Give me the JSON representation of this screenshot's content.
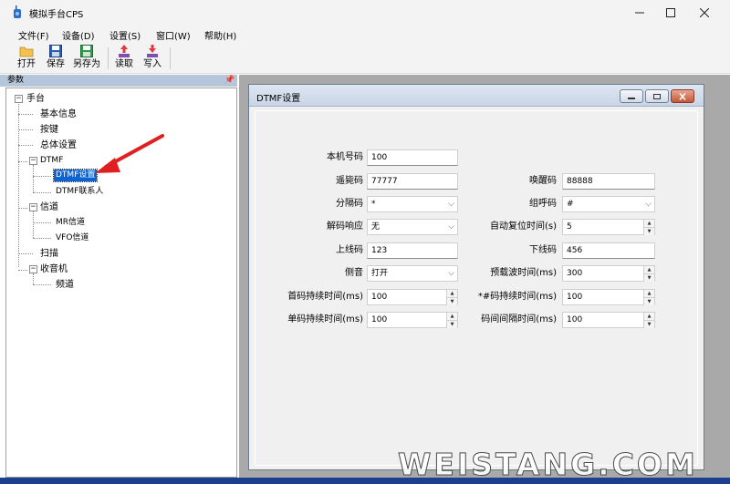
{
  "window": {
    "title": "模拟手台CPS"
  },
  "menu": [
    "文件(F)",
    "设备(D)",
    "设置(S)",
    "窗口(W)",
    "帮助(H)"
  ],
  "toolbar": {
    "open": "打开",
    "save": "保存",
    "save_as": "另存为",
    "read": "读取",
    "write": "写入"
  },
  "left_panel": {
    "title": "参数",
    "tree": {
      "root": "手台",
      "basic": "基本信息",
      "keys": "按键",
      "general": "总体设置",
      "dtmf": "DTMF",
      "dtmf_settings": "DTMF设置",
      "dtmf_contacts": "DTMF联系人",
      "channel": "信道",
      "mr_channel": "MR信道",
      "vfo_channel": "VFO信道",
      "scan": "扫描",
      "radio": "收音机",
      "freq": "频道"
    }
  },
  "dialog": {
    "title": "DTMF设置",
    "fields": {
      "local_id_label": "本机号码",
      "local_id": "100",
      "kill_label": "遥毙码",
      "kill": "77777",
      "wake_label": "唤醒码",
      "wake": "88888",
      "separator_label": "分隔码",
      "separator": "*",
      "group_label": "组呼码",
      "group": "#",
      "decode_resp_label": "解码响应",
      "decode_resp": "无",
      "auto_reset_label": "自动复位时间(s)",
      "auto_reset": "5",
      "uplink_label": "上线码",
      "uplink": "123",
      "downlink_label": "下线码",
      "downlink": "456",
      "sidetone_label": "侧音",
      "sidetone": "打开",
      "preload_label": "预载波时间(ms)",
      "preload": "300",
      "first_dur_label": "首码持续时间(ms)",
      "first_dur": "100",
      "star_dur_label": "*#码持续时间(ms)",
      "star_dur": "100",
      "single_dur_label": "单码持续时间(ms)",
      "single_dur": "100",
      "interval_label": "码间间隔时间(ms)",
      "interval": "100"
    }
  },
  "watermark": "WEISTANG.COM",
  "colors": {
    "selection": "#0a64d6",
    "arrow": "#e02020",
    "workspace": "#a9a9a9"
  }
}
